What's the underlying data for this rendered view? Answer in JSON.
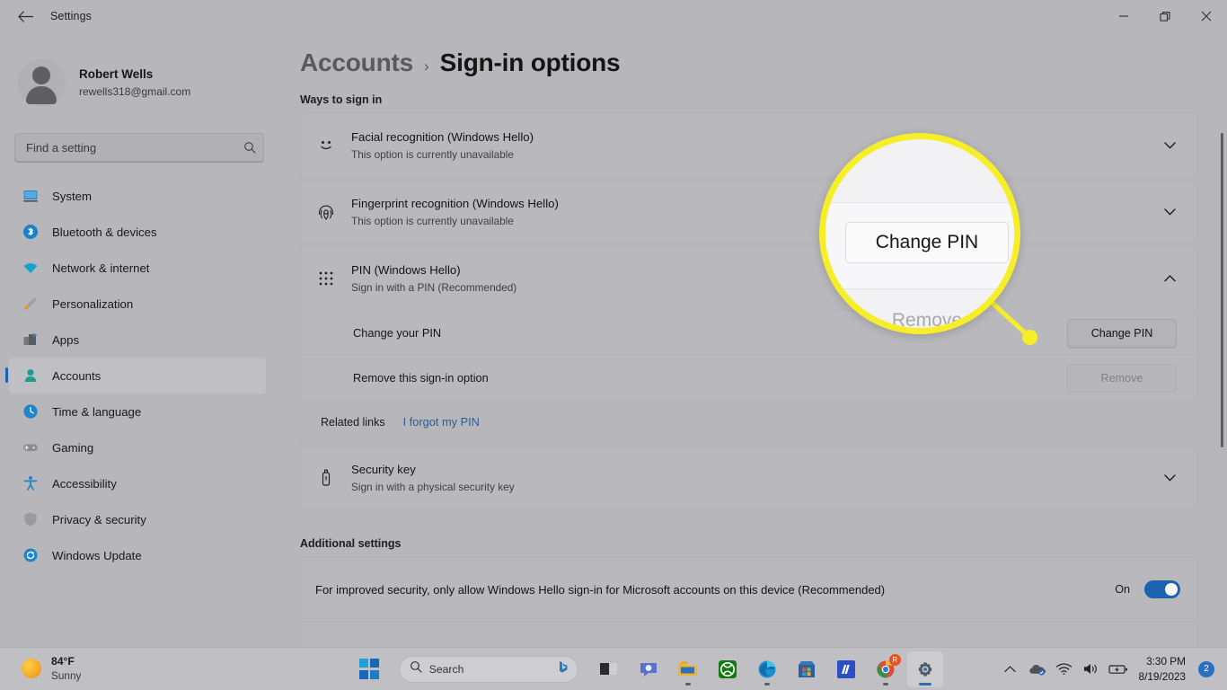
{
  "window": {
    "title": "Settings",
    "back_icon": "back-arrow-icon",
    "minimize_label": "Minimize",
    "restore_label": "Restore",
    "close_label": "Close"
  },
  "sidebar": {
    "profile": {
      "name": "Robert Wells",
      "email": "rewells318@gmail.com",
      "avatar_icon": "user-avatar-icon"
    },
    "search": {
      "placeholder": "Find a setting",
      "icon": "search-icon"
    },
    "items": [
      {
        "label": "System",
        "icon": "system-icon",
        "active": false
      },
      {
        "label": "Bluetooth & devices",
        "icon": "bluetooth-icon",
        "active": false
      },
      {
        "label": "Network & internet",
        "icon": "network-icon",
        "active": false
      },
      {
        "label": "Personalization",
        "icon": "paintbrush-icon",
        "active": false
      },
      {
        "label": "Apps",
        "icon": "apps-icon",
        "active": false
      },
      {
        "label": "Accounts",
        "icon": "accounts-icon",
        "active": true
      },
      {
        "label": "Time & language",
        "icon": "clock-icon",
        "active": false
      },
      {
        "label": "Gaming",
        "icon": "gamepad-icon",
        "active": false
      },
      {
        "label": "Accessibility",
        "icon": "accessibility-icon",
        "active": false
      },
      {
        "label": "Privacy & security",
        "icon": "shield-icon",
        "active": false
      },
      {
        "label": "Windows Update",
        "icon": "update-icon",
        "active": false
      }
    ]
  },
  "main": {
    "breadcrumb": {
      "parent": "Accounts",
      "separator": "›",
      "current": "Sign-in options"
    },
    "ways_heading": "Ways to sign in",
    "options": [
      {
        "title": "Facial recognition (Windows Hello)",
        "subtitle": "This option is currently unavailable",
        "icon": "face-icon",
        "chevron": "chevron-down-icon"
      },
      {
        "title": "Fingerprint recognition (Windows Hello)",
        "subtitle": "This option is currently unavailable",
        "icon": "fingerprint-icon",
        "chevron": "chevron-down-icon"
      },
      {
        "title": "PIN (Windows Hello)",
        "subtitle": "Sign in with a PIN (Recommended)",
        "icon": "pin-keypad-icon",
        "chevron": "chevron-up-icon"
      }
    ],
    "pin_expanded": {
      "change_row_label": "Change your PIN",
      "change_button": "Change PIN",
      "remove_row_label": "Remove this sign-in option",
      "remove_button": "Remove",
      "remove_button_disabled": true,
      "related_links_label": "Related links",
      "related_link": "I forgot my PIN"
    },
    "security_key": {
      "title": "Security key",
      "subtitle": "Sign in with a physical security key",
      "icon": "security-key-icon",
      "chevron": "chevron-down-icon"
    },
    "additional_heading": "Additional settings",
    "additional_toggle": {
      "label": "For improved security, only allow Windows Hello sign-in for Microsoft accounts on this device (Recommended)",
      "state_label": "On",
      "on": true
    }
  },
  "callout": {
    "magnified_button": "Change PIN",
    "magnified_secondary": "Remove",
    "ring_color": "#f7ee2a"
  },
  "taskbar": {
    "weather": {
      "temperature": "84°F",
      "condition": "Sunny",
      "icon": "sun-icon"
    },
    "start_label": "Start",
    "search": {
      "placeholder": "Search",
      "icon": "search-icon",
      "assistant_icon": "bing-icon"
    },
    "apps": [
      {
        "name": "task-view",
        "label": "Task view"
      },
      {
        "name": "chat",
        "label": "Chat"
      },
      {
        "name": "file-explorer",
        "label": "File Explorer"
      },
      {
        "name": "xbox",
        "label": "Xbox"
      },
      {
        "name": "edge",
        "label": "Microsoft Edge"
      },
      {
        "name": "store",
        "label": "Microsoft Store"
      },
      {
        "name": "movies-anywhere",
        "label": "App"
      },
      {
        "name": "chrome",
        "label": "Google Chrome",
        "badge": "R"
      },
      {
        "name": "settings",
        "label": "Settings",
        "active": true
      }
    ],
    "tray": {
      "overflow_icon": "chevron-up-icon",
      "onedrive_icon": "onedrive-icon",
      "wifi_icon": "wifi-icon",
      "volume_icon": "volume-icon",
      "battery_icon": "battery-charging-icon",
      "time": "3:30 PM",
      "date": "8/19/2023",
      "notification_count": "2"
    }
  },
  "colors": {
    "accent": "#1b62b4",
    "toggle_on": "#1a63ae",
    "link": "#2c5f93",
    "highlight_ring": "#f7ee2a",
    "window_bg": "#b7b7bb",
    "card_bg": "#b9b9bd"
  }
}
